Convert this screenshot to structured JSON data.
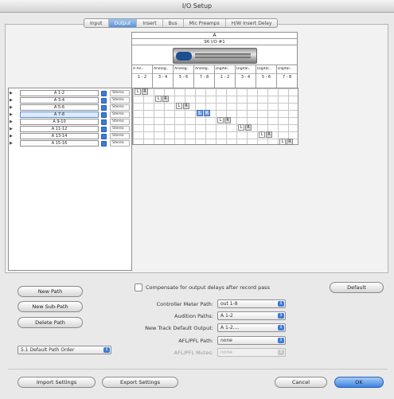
{
  "window": {
    "title": "I/O Setup"
  },
  "tabs": [
    {
      "label": "Input",
      "active": false
    },
    {
      "label": "Output",
      "active": true
    },
    {
      "label": "Insert",
      "active": false
    },
    {
      "label": "Bus",
      "active": false
    },
    {
      "label": "Mic Preamps",
      "active": false
    },
    {
      "label": "H/W Insert Delay",
      "active": false
    }
  ],
  "grid_header": {
    "group": "A",
    "device": "96 I/O #1",
    "channel_names": [
      "A  An..",
      "Analog..",
      "Analog..",
      "Analog..",
      "Digital..",
      "Digital..",
      "Digital..",
      "Digital.."
    ],
    "channel_numbers": [
      "1 - 2",
      "3 - 4",
      "5 - 6",
      "7 - 8",
      "1 - 2",
      "3 - 4",
      "5 - 6",
      "7 - 8"
    ]
  },
  "paths": [
    {
      "name": "A 1-2",
      "format": "Stereo",
      "selected": false
    },
    {
      "name": "A 3-4",
      "format": "Stereo",
      "selected": false
    },
    {
      "name": "A 5-6",
      "format": "Stereo",
      "selected": false
    },
    {
      "name": "A 7-8",
      "format": "Stereo",
      "selected": true
    },
    {
      "name": "A 9-10",
      "format": "Stereo",
      "selected": false
    },
    {
      "name": "A 11-12",
      "format": "Stereo",
      "selected": false
    },
    {
      "name": "A 13-14",
      "format": "Stereo",
      "selected": false
    },
    {
      "name": "A 15-16",
      "format": "Stereo",
      "selected": false
    }
  ],
  "assignments": {
    "left": "L",
    "right": "R"
  },
  "buttons": {
    "new_path": "New Path",
    "new_sub_path": "New Sub-Path",
    "delete_path": "Delete Path",
    "default": "Default",
    "import": "Import Settings",
    "export": "Export Settings",
    "cancel": "Cancel",
    "ok": "OK"
  },
  "compensate": {
    "label": "Compensate for output delays after record pass",
    "checked": false
  },
  "settings": [
    {
      "label": "Controller Meter Path:",
      "value": "out 1-8",
      "disabled": false
    },
    {
      "label": "Audition Paths:",
      "value": "A 1-2",
      "disabled": false
    },
    {
      "label": "New Track Default Output:",
      "value": "A 1-2....",
      "disabled": false
    },
    {
      "label": "AFL/PFL Path:",
      "value": "none",
      "disabled": false
    },
    {
      "label": "AFL/PFL Mutes:",
      "value": "none",
      "disabled": true
    }
  ],
  "path_order": {
    "value": "5.1 Default Path Order"
  }
}
